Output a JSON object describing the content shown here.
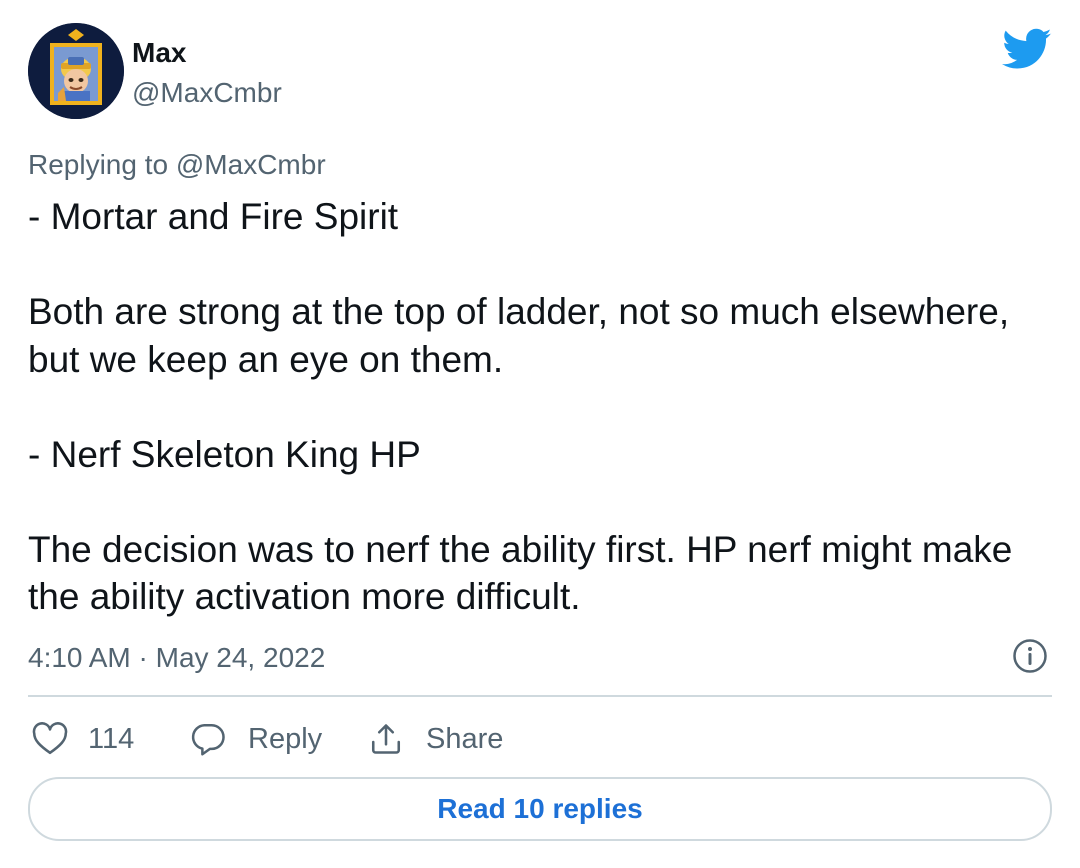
{
  "author": {
    "display_name": "Max",
    "handle": "@MaxCmbr",
    "avatar_icon": "profile-avatar-helmet-character"
  },
  "brand": {
    "icon": "twitter-bird-icon",
    "color": "#1d9bf0"
  },
  "replying": {
    "prefix": "Replying to ",
    "mention": "@MaxCmbr"
  },
  "tweet": {
    "paragraphs": [
      "- Mortar and Fire Spirit",
      "Both are strong at the top of ladder, not so much elsewhere, but we keep an eye on them.",
      "- Nerf Skeleton King HP",
      "The decision was to nerf the ability first. HP nerf might make the ability activation more difficult."
    ],
    "timestamp": "4:10 AM · May 24, 2022"
  },
  "actions": {
    "like_count": "114",
    "reply_label": "Reply",
    "share_label": "Share"
  },
  "read_replies_label": "Read 10 replies",
  "colors": {
    "text_primary": "#0f1419",
    "text_secondary": "#536471",
    "link": "#1d70d6",
    "border": "#cfd9de"
  }
}
